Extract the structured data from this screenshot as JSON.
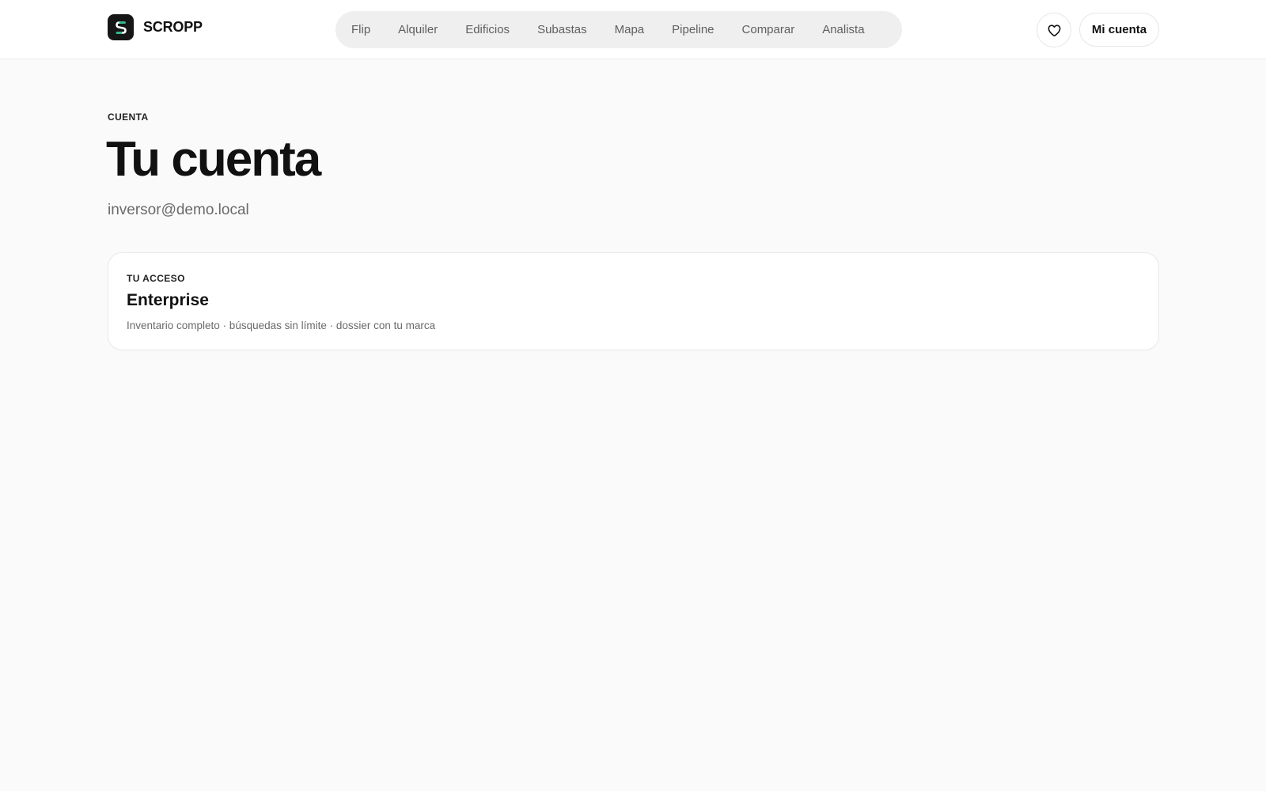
{
  "header": {
    "brand_name": "SCROPP",
    "nav_items": [
      "Flip",
      "Alquiler",
      "Edificios",
      "Subastas",
      "Mapa",
      "Pipeline",
      "Comparar",
      "Analista"
    ],
    "favorites_icon": "heart-icon",
    "account_label": "Mi cuenta"
  },
  "main": {
    "eyebrow": "CUENTA",
    "title": "Tu cuenta",
    "email": "inversor@demo.local"
  },
  "access_card": {
    "eyebrow": "TU ACCESO",
    "plan": "Enterprise",
    "description": "Inventario completo · búsquedas sin límite · dossier con tu marca"
  },
  "colors": {
    "accent": "#22c08a",
    "logo_bg": "#161616",
    "nav_bg": "#efefef",
    "page_bg": "#fafafa"
  }
}
